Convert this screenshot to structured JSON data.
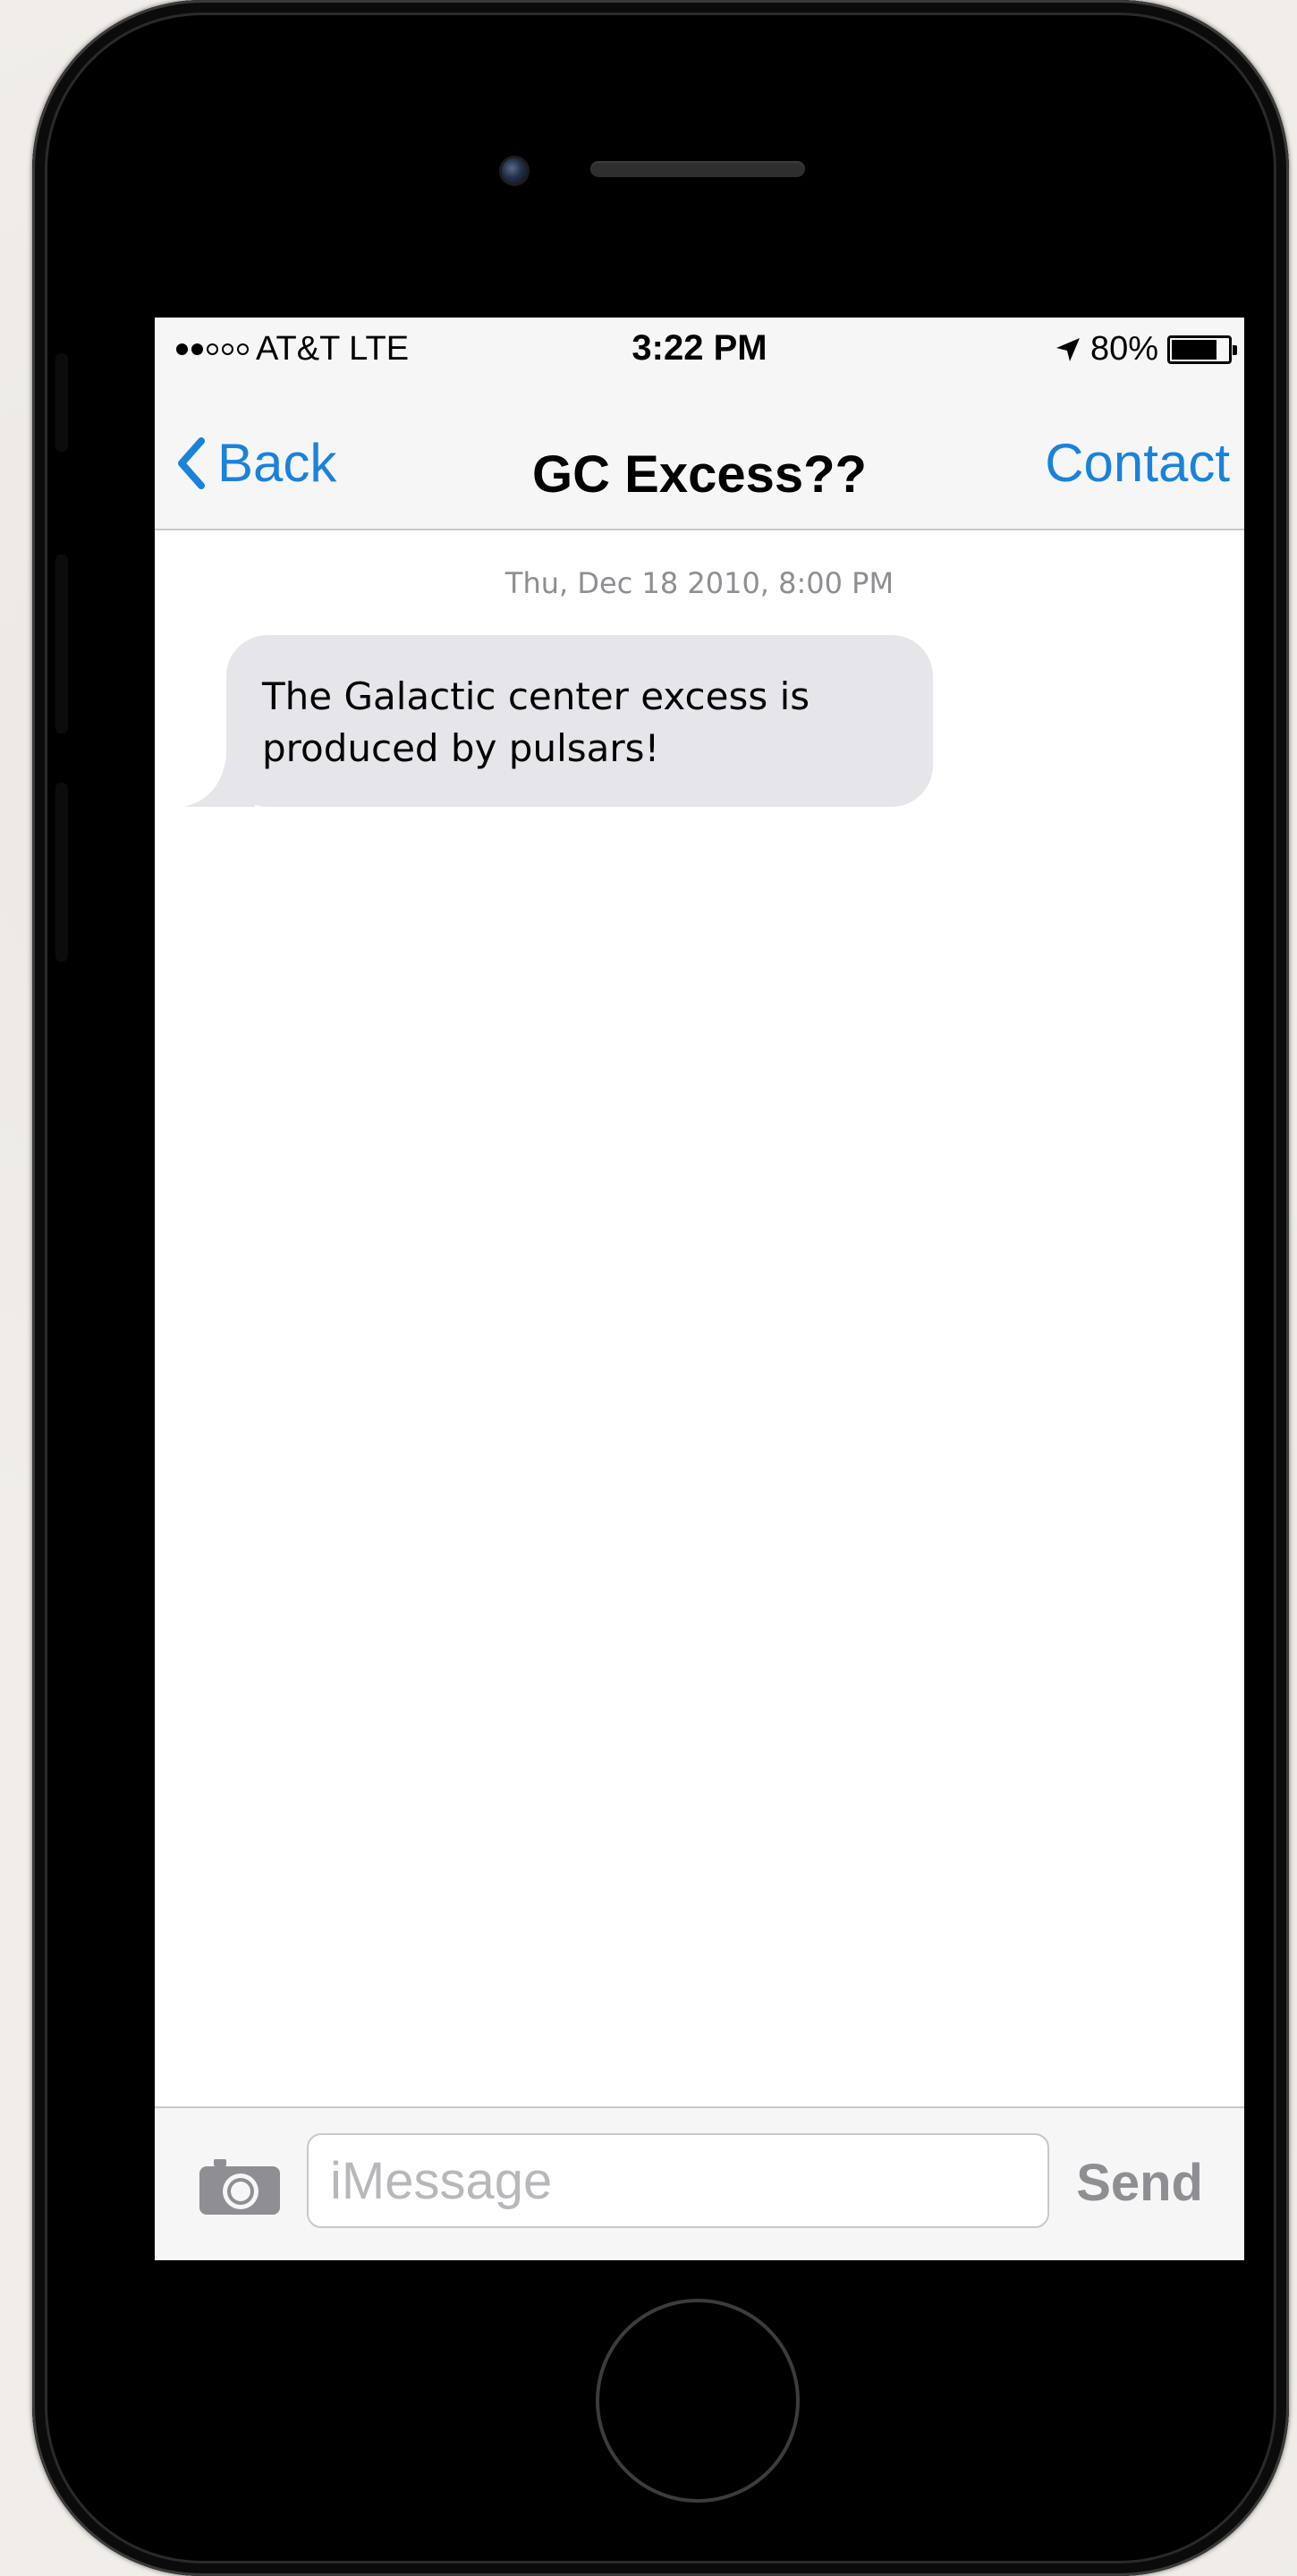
{
  "status_bar": {
    "signal_full": 2,
    "signal_empty": 3,
    "carrier": "AT&T LTE",
    "time": "3:22 PM",
    "location_icon": "location-arrow-icon",
    "battery_percent": "80%",
    "battery_level": 0.8
  },
  "nav": {
    "back_label": "Back",
    "title": "GC Excess??",
    "contact_label": "Contact"
  },
  "conversation": {
    "timestamp": "Thu, Dec 18 2010, 8:00 PM",
    "messages": [
      {
        "direction": "incoming",
        "line1": "The Galactic center excess is",
        "line2": "produced by pulsars!"
      }
    ]
  },
  "input_bar": {
    "camera_icon": "camera-icon",
    "placeholder": "iMessage",
    "value": "",
    "send_label": "Send"
  },
  "colors": {
    "accent": "#1a82db",
    "bubble_incoming": "#e5e5ea",
    "bar_background": "#f6f6f7",
    "muted": "#8e8e93"
  }
}
